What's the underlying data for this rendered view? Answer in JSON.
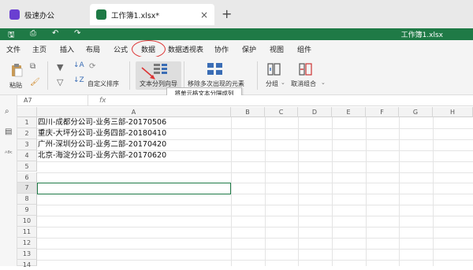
{
  "tabs": [
    {
      "label": "极速办公"
    },
    {
      "label": "工作簿1.xlsx*"
    }
  ],
  "document_title": "工作簿1.xlsx",
  "menu": [
    "文件",
    "主页",
    "插入",
    "布局",
    "公式",
    "数据",
    "数据透视表",
    "协作",
    "保护",
    "视图",
    "组件"
  ],
  "active_menu": "数据",
  "ribbon": {
    "paste": "粘贴",
    "custom_sort": "自定义排序",
    "text_to_columns": "文本分列向导",
    "remove_duplicates": "移除多次出现的元素",
    "group": "分组",
    "ungroup": "取消组合"
  },
  "tooltip": "将单元格文本分隔成列",
  "name_box": "A7",
  "fx": "fx",
  "columns": [
    "A",
    "B",
    "C",
    "D",
    "E",
    "F",
    "G",
    "H"
  ],
  "rows": [
    "1",
    "2",
    "3",
    "4",
    "5",
    "6",
    "7",
    "8",
    "9",
    "10",
    "11",
    "12",
    "13",
    "14"
  ],
  "cells": [
    "四川-成都分公司-业务三部-20170506",
    "重庆-大坪分公司-业务四部-20180410",
    "广州-深圳分公司-业务二部-20170420",
    "北京-海淀分公司-业务六部-20170620"
  ],
  "colors": {
    "accent_green": "#1f7a46",
    "tab_icon_purple": "#6a3fd1",
    "highlight_red": "#dd3333"
  }
}
